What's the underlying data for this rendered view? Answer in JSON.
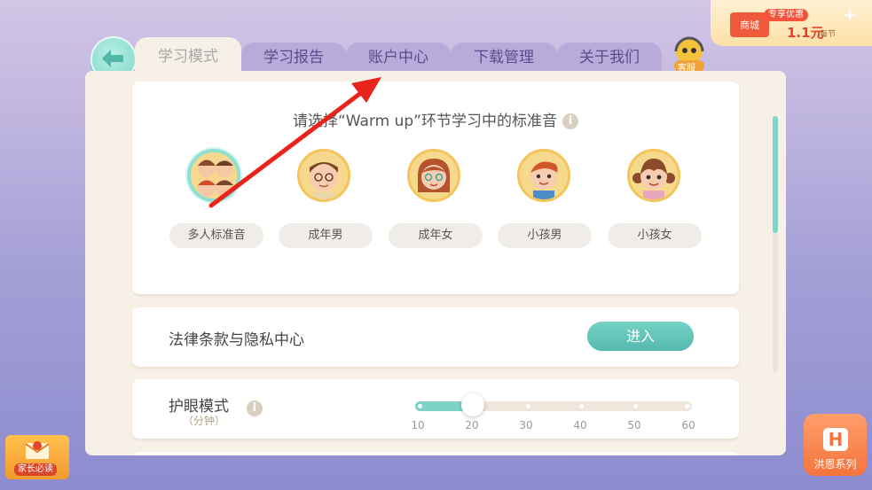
{
  "tabs": [
    {
      "label": "学习模式",
      "active": true
    },
    {
      "label": "学习报告",
      "active": false
    },
    {
      "label": "账户中心",
      "active": false
    },
    {
      "label": "下载管理",
      "active": false
    },
    {
      "label": "关于我们",
      "active": false
    }
  ],
  "service": {
    "label": "客服"
  },
  "shop": {
    "badge": "专享优惠",
    "cart_label": "商城",
    "price": "1.1元",
    "per": "/每节"
  },
  "voice_section": {
    "title": "请选择“Warm up”环节学习中的标准音",
    "options": [
      {
        "label": "多人标准音",
        "selected": true
      },
      {
        "label": "成年男",
        "selected": false
      },
      {
        "label": "成年女",
        "selected": false
      },
      {
        "label": "小孩男",
        "selected": false
      },
      {
        "label": "小孩女",
        "selected": false
      }
    ]
  },
  "legal": {
    "label": "法律条款与隐私中心",
    "button": "进入"
  },
  "eye_care": {
    "label": "护眼模式",
    "sub": "（分钟）",
    "ticks": [
      "10",
      "20",
      "30",
      "40",
      "50",
      "60"
    ],
    "value": 20
  },
  "parents": {
    "label": "家长必读"
  },
  "hongen": {
    "label": "洪恩系列",
    "logo": "H"
  },
  "colors": {
    "accent": "#6fcfc2",
    "tab": "#b8abd9",
    "panel": "#f6f0e7",
    "annotation": "#e8231c"
  }
}
